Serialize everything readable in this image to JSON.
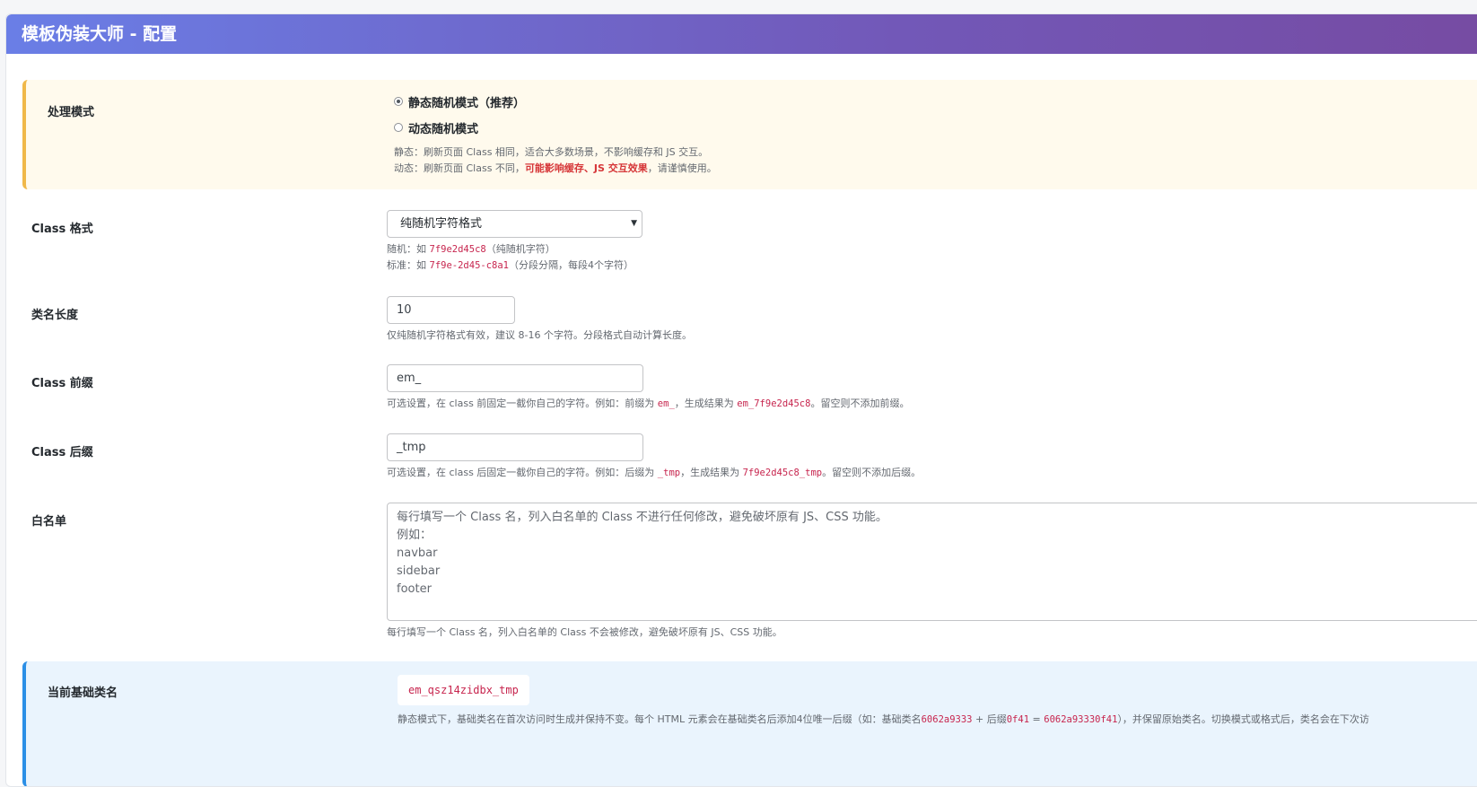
{
  "header": {
    "title": "模板伪装大师 - 配置"
  },
  "mode": {
    "label": "处理模式",
    "options": [
      {
        "label": "静态随机模式（推荐）",
        "checked": true
      },
      {
        "label": "动态随机模式",
        "checked": false
      }
    ],
    "desc_static": "静态：刷新页面 Class 相同，适合大多数场景，不影响缓存和 JS 交互。",
    "desc_dynamic_pre": "动态：刷新页面 Class 不同，",
    "desc_dynamic_warn": "可能影响缓存、JS 交互效果",
    "desc_dynamic_post": "，请谨慎使用。"
  },
  "class_format": {
    "label": "Class 格式",
    "selected": "纯随机字符格式",
    "desc1_pre": "随机：如 ",
    "desc1_code": "7f9e2d45c8",
    "desc1_post": "（纯随机字符）",
    "desc2_pre": "标准：如 ",
    "desc2_code": "7f9e-2d45-c8a1",
    "desc2_post": "（分段分隔，每段4个字符）"
  },
  "length": {
    "label": "类名长度",
    "value": "10",
    "desc": "仅纯随机字符格式有效，建议 8-16 个字符。分段格式自动计算长度。"
  },
  "prefix": {
    "label": "Class 前缀",
    "value": "em_",
    "desc_a": "可选设置，在 class 前固定一截你自己的字符。例如：前缀为 ",
    "desc_code1": "em_",
    "desc_b": "，生成结果为 ",
    "desc_code2": "em_7f9e2d45c8",
    "desc_c": "。留空则不添加前缀。"
  },
  "suffix": {
    "label": "Class 后缀",
    "value": "_tmp",
    "desc_a": "可选设置，在 class 后固定一截你自己的字符。例如：后缀为 ",
    "desc_code1": "_tmp",
    "desc_b": "，生成结果为 ",
    "desc_code2": "7f9e2d45c8_tmp",
    "desc_c": "。留空则不添加后缀。"
  },
  "whitelist": {
    "label": "白名单",
    "placeholder_lines": [
      "每行填写一个 Class 名，列入白名单的 Class 不进行任何修改，避免破坏原有 JS、CSS 功能。",
      "例如：",
      "navbar",
      "sidebar",
      "footer"
    ],
    "desc": "每行填写一个 Class 名，列入白名单的 Class 不会被修改，避免破坏原有 JS、CSS 功能。"
  },
  "base": {
    "label": "当前基础类名",
    "value": "em_qsz14zidbx_tmp",
    "desc_a": "静态模式下，基础类名在首次访问时生成并保持不变。每个 HTML 元素会在基础类名后添加4位唯一后缀（如：基础类名",
    "code1": "6062a9333",
    "desc_b": " + 后缀",
    "code2": "0f41",
    "desc_c": " = ",
    "code3": "6062a93330f41",
    "desc_d": "），并保留原始类名。切换模式或格式后，类名会在下次访"
  },
  "colors": {
    "header_start": "#6a7ee6",
    "header_end": "#764ba2",
    "warn_border": "#f0b849",
    "info_border": "#2b8fe6",
    "code": "#c7254e"
  }
}
